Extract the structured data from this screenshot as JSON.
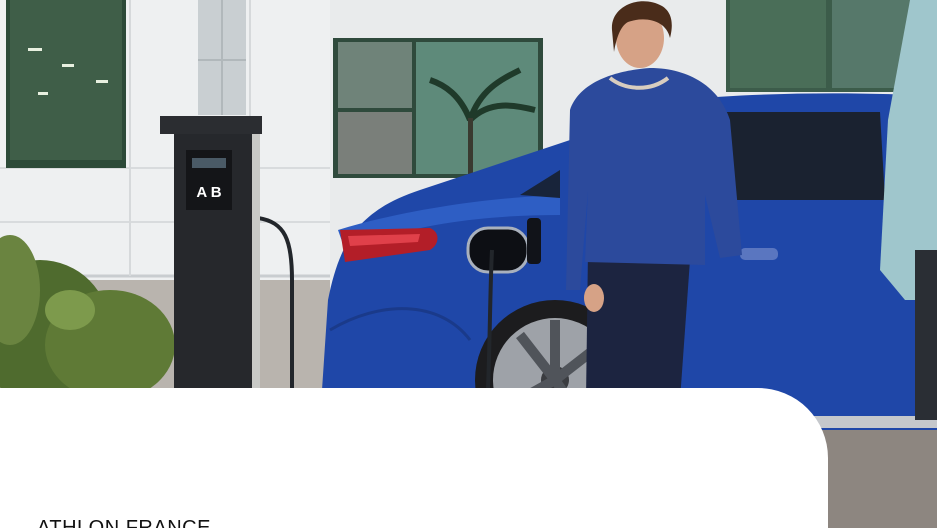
{
  "hero": {
    "charger_label": "A B"
  },
  "panel": {
    "headline": "ATHLON FRANCE"
  }
}
